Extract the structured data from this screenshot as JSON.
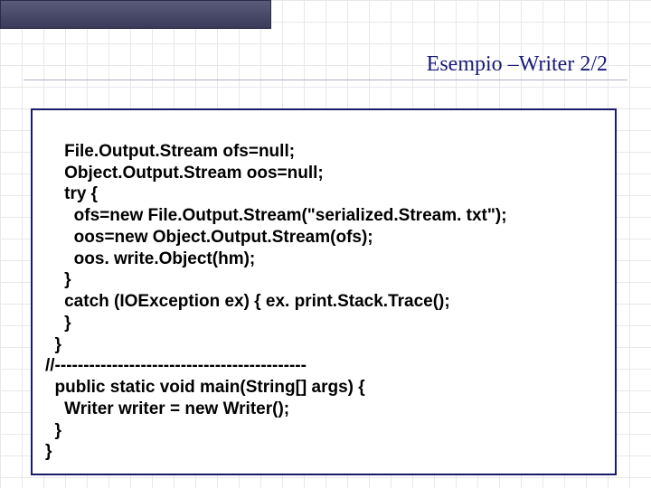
{
  "slide": {
    "title": "Esempio –Writer 2/2"
  },
  "code": {
    "lines": [
      "    File.Output.Stream ofs=null;",
      "    Object.Output.Stream oos=null;",
      "    try {",
      "      ofs=new File.Output.Stream(\"serialized.Stream. txt\");",
      "      oos=new Object.Output.Stream(ofs);",
      "      oos. write.Object(hm);",
      "    }",
      "    catch (IOException ex) { ex. print.Stack.Trace(); ",
      "    }",
      "  }",
      "//--------------------------------------------",
      "  public static void main(String[] args) {",
      "    Writer writer = new Writer();",
      "  }",
      "}"
    ]
  }
}
